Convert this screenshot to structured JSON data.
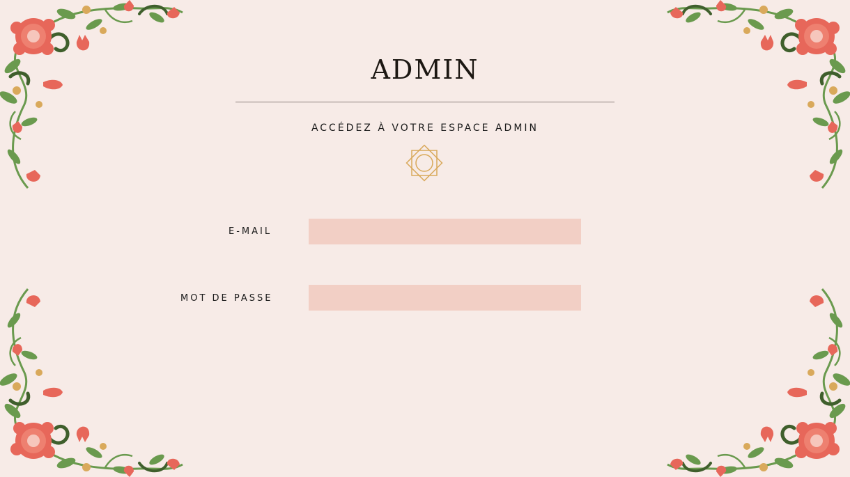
{
  "header": {
    "title": "ADMIN",
    "subtitle": "ACCÉDEZ À VOTRE ESPACE ADMIN"
  },
  "form": {
    "email": {
      "label": "E-MAIL",
      "value": "",
      "placeholder": ""
    },
    "password": {
      "label": "MOT DE PASSE",
      "value": "",
      "placeholder": ""
    }
  },
  "decor": {
    "corner_icon": "floral-corner-icon",
    "ornament_icon": "star-ornament-icon",
    "colors": {
      "background": "#f7ebe7",
      "input_fill": "#f2cfc5",
      "flower_red": "#e7675a",
      "leaf_green": "#6a9a4e",
      "dark_green": "#3f5f2c",
      "gold": "#d9a95b",
      "rule": "#8a7f7a"
    }
  }
}
